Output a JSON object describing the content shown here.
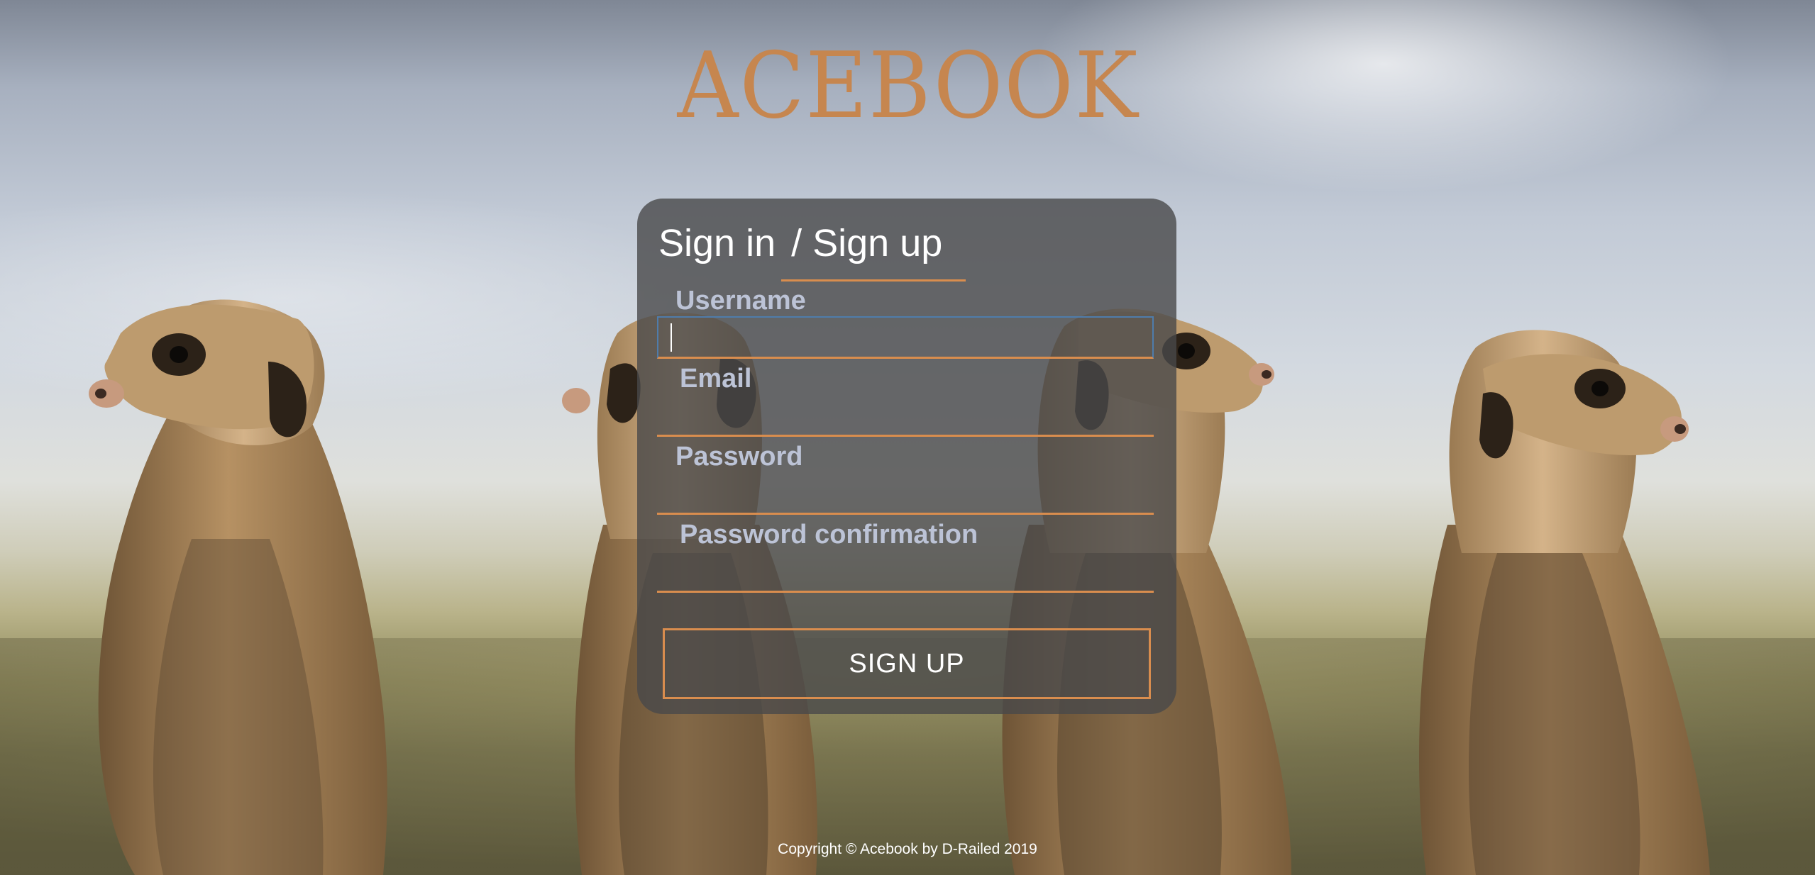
{
  "logo": {
    "text": "ACEBOOK"
  },
  "auth_panel": {
    "sign_in_label": "Sign in",
    "sign_up_label": "/ Sign up",
    "fields": {
      "username_label": "Username",
      "email_label": "Email",
      "password_label": "Password",
      "password_confirmation_label": "Password confirmation"
    },
    "submit_label": "SIGN UP"
  },
  "footer": {
    "text": "Copyright © Acebook by D-Railed 2019"
  },
  "colors": {
    "accent": "#d98d4e",
    "logo": "#c6864f",
    "panel_background": "#48484a",
    "label": "#bcc3d6",
    "text": "#ffffff"
  },
  "background": {
    "subject": "four meerkats standing upright against a cloudy sky"
  }
}
